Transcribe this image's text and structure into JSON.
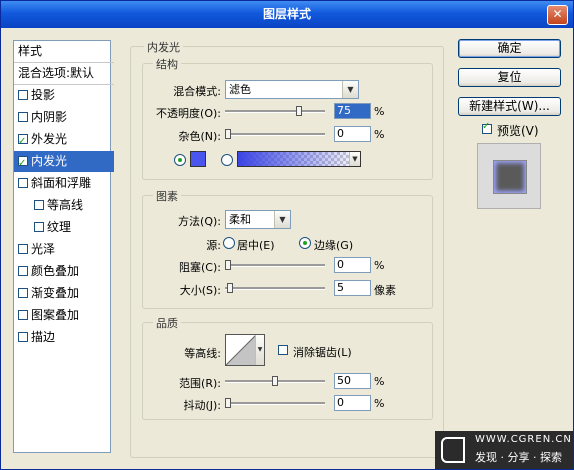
{
  "window": {
    "title": "图层样式",
    "close_glyph": "✕"
  },
  "sidebar": {
    "header": "样式",
    "blend": "混合选项:默认",
    "items": [
      {
        "label": "投影",
        "checked": false,
        "indent": false,
        "selected": false
      },
      {
        "label": "内阴影",
        "checked": false,
        "indent": false,
        "selected": false
      },
      {
        "label": "外发光",
        "checked": true,
        "indent": false,
        "selected": false
      },
      {
        "label": "内发光",
        "checked": true,
        "indent": false,
        "selected": true
      },
      {
        "label": "斜面和浮雕",
        "checked": false,
        "indent": false,
        "selected": false
      },
      {
        "label": "等高线",
        "checked": false,
        "indent": true,
        "selected": false
      },
      {
        "label": "纹理",
        "checked": false,
        "indent": true,
        "selected": false
      },
      {
        "label": "光泽",
        "checked": false,
        "indent": false,
        "selected": false
      },
      {
        "label": "颜色叠加",
        "checked": false,
        "indent": false,
        "selected": false
      },
      {
        "label": "渐变叠加",
        "checked": false,
        "indent": false,
        "selected": false
      },
      {
        "label": "图案叠加",
        "checked": false,
        "indent": false,
        "selected": false
      },
      {
        "label": "描边",
        "checked": false,
        "indent": false,
        "selected": false
      }
    ]
  },
  "inner_glow": {
    "title": "内发光",
    "structure": {
      "title": "结构",
      "blend_mode_label": "混合模式:",
      "blend_mode": "滤色",
      "opacity_label": "不透明度(O):",
      "opacity": "75",
      "opacity_level": 0.75,
      "noise_label": "杂色(N):",
      "noise": "0",
      "noise_level": 0,
      "percent": "%",
      "glow_color": "#4a55ee",
      "gradient_color": "#3b45e3"
    },
    "elements": {
      "title": "图素",
      "technique_label": "方法(Q):",
      "technique": "柔和",
      "source_label": "源:",
      "source_center": "居中(E)",
      "source_edge": "边缘(G)",
      "source_selected": "edge",
      "choke_label": "阻塞(C):",
      "choke": "0",
      "choke_level": 0,
      "size_label": "大小(S):",
      "size": "5",
      "size_level": 0.02,
      "size_unit": "像素",
      "percent": "%"
    },
    "quality": {
      "title": "品质",
      "contour_label": "等高线:",
      "antialias_label": "消除锯齿(L)",
      "antialias": false,
      "range_label": "范围(R):",
      "range": "50",
      "range_level": 0.5,
      "jitter_label": "抖动(J):",
      "jitter": "0",
      "jitter_level": 0,
      "percent": "%"
    }
  },
  "buttons": {
    "ok": "确定",
    "reset": "复位",
    "new_style": "新建样式(W)...",
    "preview_label": "预览(V)",
    "preview_checked": true
  },
  "watermark": {
    "site": "WWW.CGREN.CN",
    "slogan": "发现 · 分享 · 探索"
  }
}
